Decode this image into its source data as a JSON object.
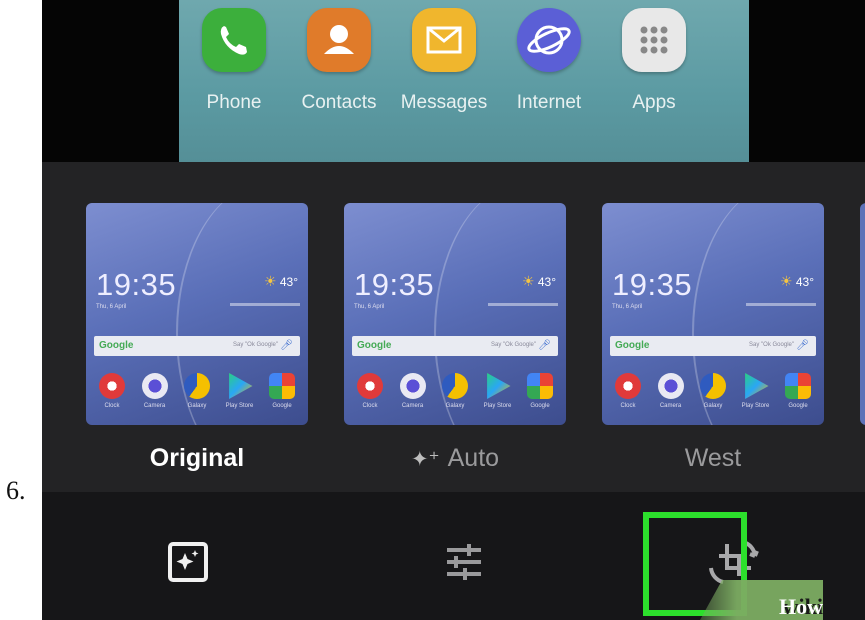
{
  "step_number": "6.",
  "home_dock": {
    "apps": [
      {
        "label": "Phone",
        "icon": "phone-icon",
        "color": "#3caf3c"
      },
      {
        "label": "Contacts",
        "icon": "contacts-icon",
        "color": "#e07b2a"
      },
      {
        "label": "Messages",
        "icon": "messages-icon",
        "color": "#f0b62d"
      },
      {
        "label": "Internet",
        "icon": "internet-icon",
        "color": "#5b5fd6"
      },
      {
        "label": "Apps",
        "icon": "apps-grid-icon",
        "color": "#e8e8e8"
      }
    ]
  },
  "thumbnail_content": {
    "time": "19:35",
    "date": "Thu, 6 April",
    "temperature": "43°",
    "search_logo": "Google",
    "search_hint": "Say \"Ok Google\"",
    "apps": [
      "Clock",
      "Camera",
      "Galaxy",
      "Play Store",
      "Google"
    ]
  },
  "filters": [
    {
      "label": "Original",
      "state": "selected"
    },
    {
      "label": "Auto",
      "state": "normal"
    },
    {
      "label": "West",
      "state": "normal"
    }
  ],
  "toolbar": {
    "tools": [
      {
        "name": "auto-adjust-icon"
      },
      {
        "name": "adjust-sliders-icon"
      },
      {
        "name": "crop-rotate-icon",
        "highlighted": true
      }
    ]
  },
  "watermark": {
    "wiki": "wiki",
    "how": "How"
  },
  "colors": {
    "highlight": "#2ce02c",
    "watermark_green": "#7cac62"
  }
}
